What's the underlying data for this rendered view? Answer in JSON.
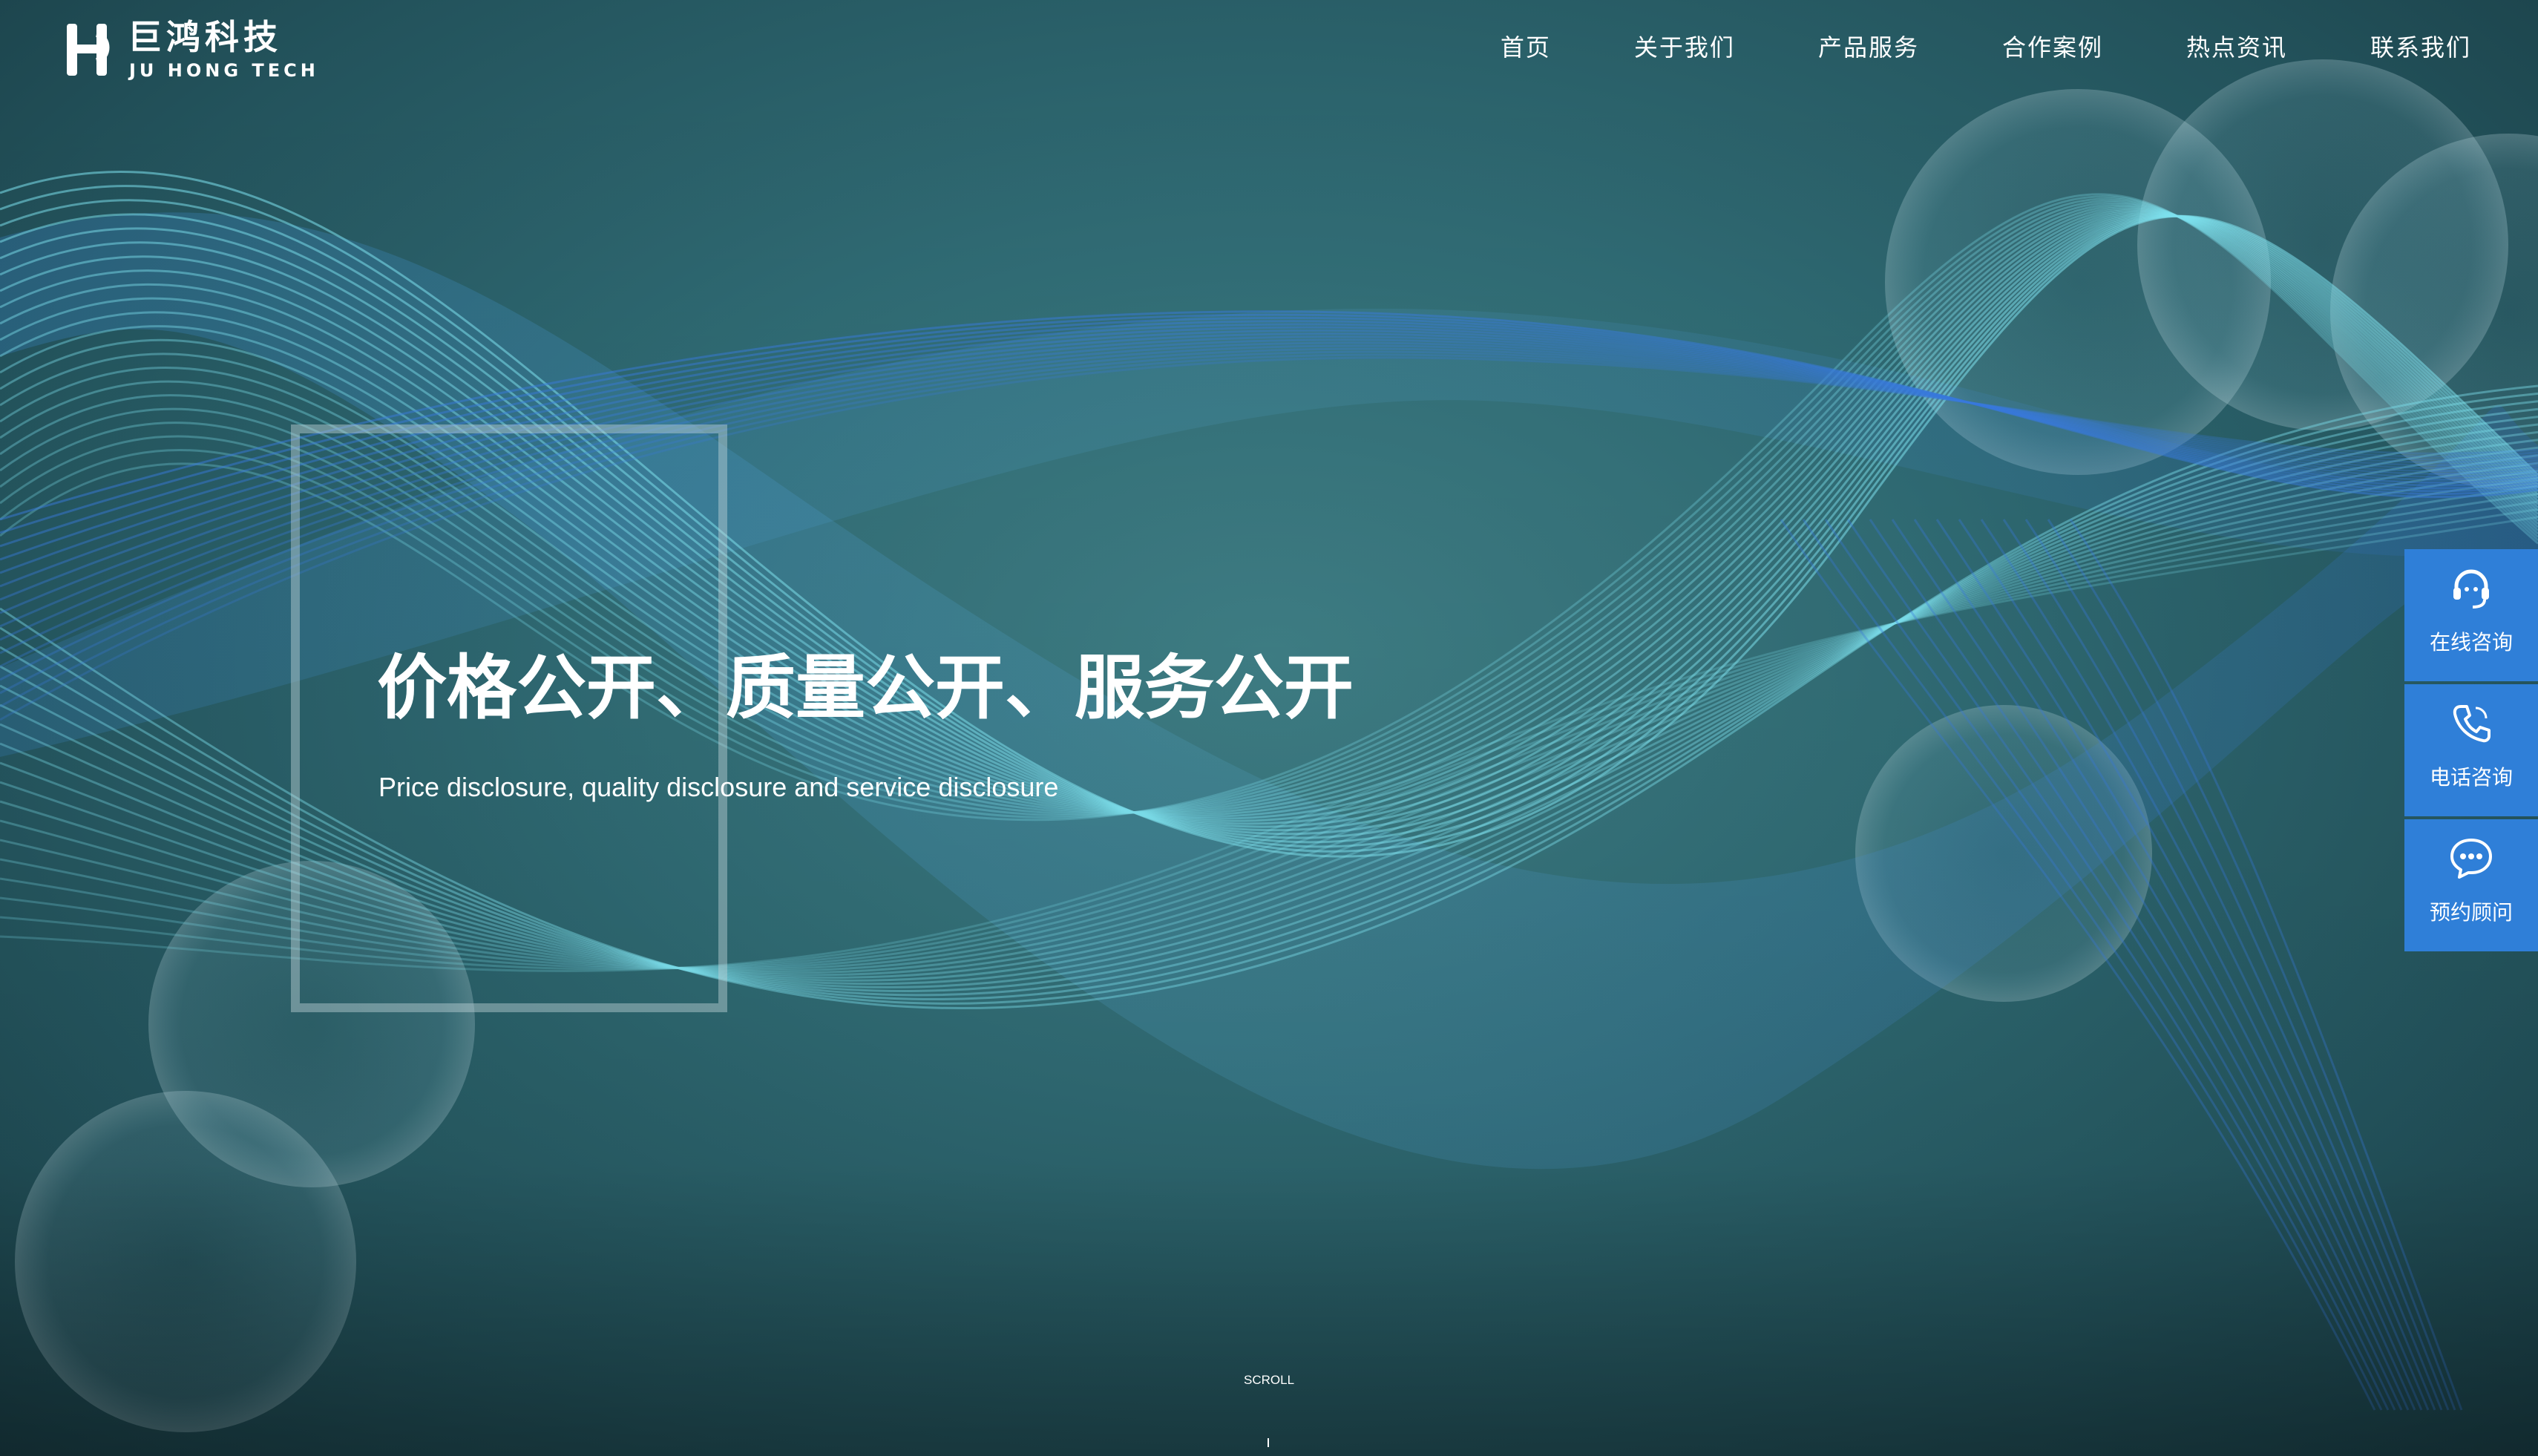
{
  "brand": {
    "name_cn": "巨鸿科技",
    "name_en": "JU HONG TECH"
  },
  "nav": {
    "items": [
      {
        "label": "首页"
      },
      {
        "label": "关于我们"
      },
      {
        "label": "产品服务"
      },
      {
        "label": "合作案例"
      },
      {
        "label": "热点资讯"
      },
      {
        "label": "联系我们"
      }
    ]
  },
  "hero": {
    "title": "价格公开、质量公开、服务公开",
    "subtitle": "Price disclosure, quality disclosure and service disclosure",
    "scroll_label": "SCROLL"
  },
  "side_panel": {
    "items": [
      {
        "label": "在线咨询",
        "icon": "headset-icon"
      },
      {
        "label": "电话咨询",
        "icon": "phone-icon"
      },
      {
        "label": "预约顾问",
        "icon": "chat-bubble-icon"
      }
    ]
  },
  "colors": {
    "background": "#2f6a73",
    "side_panel": "#2f7fd8",
    "wave_light": "#7fe3f0",
    "wave_blue": "#3a7be0",
    "text": "#ffffff"
  }
}
